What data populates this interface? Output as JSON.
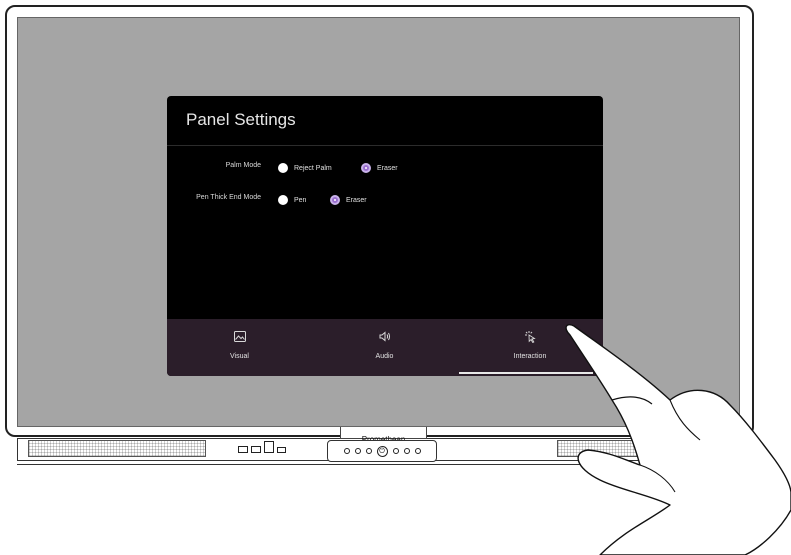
{
  "panel": {
    "title": "Panel Settings",
    "settings": [
      {
        "label": "Palm Mode",
        "options": [
          {
            "label": "Reject Palm",
            "selected": false
          },
          {
            "label": "Eraser",
            "selected": true
          }
        ]
      },
      {
        "label": "Pen Thick End Mode",
        "options": [
          {
            "label": "Pen",
            "selected": false
          },
          {
            "label": "Eraser",
            "selected": true
          }
        ]
      }
    ],
    "nav": [
      {
        "label": "Visual",
        "icon": "image-icon",
        "active": false
      },
      {
        "label": "Audio",
        "icon": "speaker-icon",
        "active": false
      },
      {
        "label": "Interaction",
        "icon": "touch-pointer-icon",
        "active": true
      }
    ]
  },
  "monitor": {
    "brand": "Promethean",
    "colors": {
      "screen": "#a5a5a5",
      "panel_bg": "#000000",
      "navbar_bg": "#2b1e2a",
      "accent": "#9b6fd0"
    }
  }
}
